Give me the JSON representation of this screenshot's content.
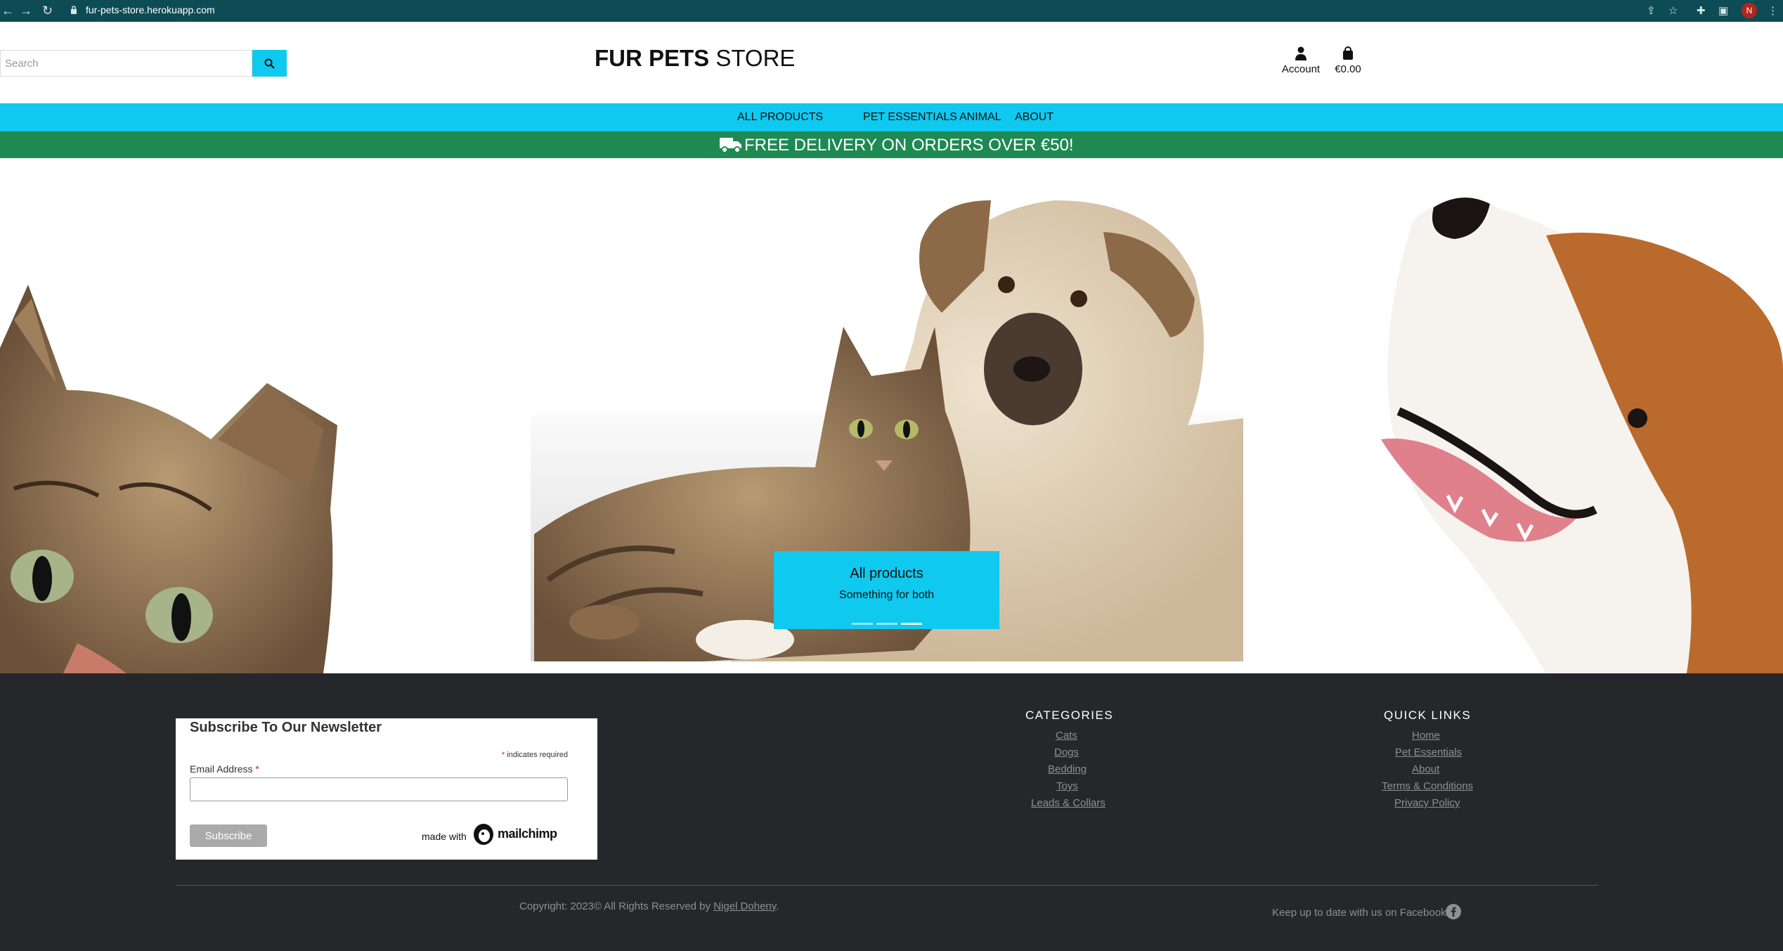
{
  "browser": {
    "url": "fur-pets-store.herokuapp.com",
    "profile_initial": "N"
  },
  "header": {
    "search_placeholder": "Search",
    "logo_bold": "FUR PETS",
    "logo_light": " STORE",
    "account_label": "Account",
    "bag_total": "€0.00"
  },
  "nav": {
    "items": [
      {
        "label": "ALL PRODUCTS"
      },
      {
        "label": "PET ESSENTIALS"
      },
      {
        "label": "ANIMAL"
      },
      {
        "label": "ABOUT"
      }
    ]
  },
  "banner": {
    "delivery_message": "FREE DELIVERY ON ORDERS OVER €50!"
  },
  "carousel": {
    "caption_title": "All products",
    "caption_subtitle": "Something for both",
    "slide_count": 3,
    "active_slide": 3
  },
  "newsletter": {
    "title": "Subscribe To Our Newsletter",
    "required_star": "*",
    "required_note": " indicates required",
    "email_label": "Email Address ",
    "subscribe_label": "Subscribe",
    "made_with": "made with",
    "mailchimp_logo": "mailchimp"
  },
  "footer": {
    "categories_title": "CATEGORIES",
    "categories": [
      "Cats",
      "Dogs",
      "Bedding",
      "Toys",
      "Leads & Collars"
    ],
    "quick_links_title": "QUICK LINKS",
    "quick_links": [
      "Home",
      "Pet Essentials",
      "About",
      "Terms & Conditions",
      "Privacy Policy"
    ],
    "copyright_prefix": "Copyright: 2023© All Rights Reserved by ",
    "copyright_author": "Nigel Doheny",
    "copyright_suffix": ".",
    "facebook_text": "Keep up to date with us on Facebook"
  },
  "colors": {
    "browser_bar": "#0e4c55",
    "accent_cyan": "#0fc9ef",
    "delivery_green": "#1e8a52",
    "footer_bg": "#26272b"
  }
}
